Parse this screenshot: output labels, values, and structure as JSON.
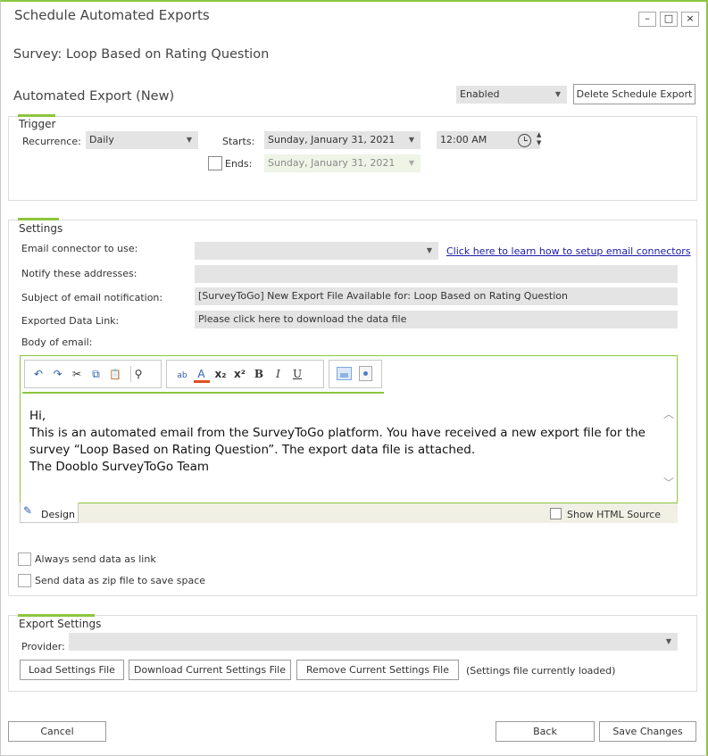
{
  "window": {
    "title": "Schedule Automated Exports",
    "minimize": "–",
    "maximize": "□",
    "close": "×"
  },
  "survey_title": "Survey: Loop Based on Rating Question",
  "export_title": "Automated Export (New)",
  "status_select": "Enabled",
  "delete_button": "Delete Schedule Export",
  "trigger": {
    "label": "Trigger",
    "recurrence_label": "Recurrence:",
    "recurrence_value": "Daily",
    "starts_label": "Starts:",
    "starts_value": "Sunday, January 31, 2021",
    "time_value": "12:00 AM",
    "ends_label": "Ends:",
    "ends_value": "Sunday, January 31, 2021"
  },
  "settings": {
    "label": "Settings",
    "connector_label": "Email connector to use:",
    "connector_value": "",
    "connector_link": "Click here to learn how to setup email connectors",
    "notify_label": "Notify these addresses:",
    "notify_value": "",
    "subject_label": "Subject of email notification:",
    "subject_value": "[SurveyToGo] New Export File Available for: Loop Based on Rating Question",
    "link_label": "Exported Data Link:",
    "link_value": "Please click here to download the data file",
    "body_label": "Body of email:",
    "body_lines": [
      "Hi,",
      "This is an automated email from the SurveyToGo platform. You have received a new export file for the",
      "survey “Loop Based on Rating Question”. The export data file is attached.",
      "The Dooblo SurveyToGo Team"
    ],
    "design_tab": "Design",
    "show_html": "Show HTML Source",
    "always_link": "Always send data as link",
    "zip": "Send data as zip file to save space"
  },
  "export_settings": {
    "label": "Export Settings",
    "provider_label": "Provider:",
    "provider_value": "",
    "load_button": "Load Settings File",
    "download_button": "Download Current Settings File",
    "remove_button": "Remove Current Settings File",
    "status_text": "(Settings file currently loaded)"
  },
  "footer": {
    "cancel": "Cancel",
    "back": "Back",
    "save": "Save Changes"
  },
  "toolbar": {
    "undo": "↶",
    "redo": "↷",
    "cut": "✂",
    "copy": "⧉",
    "paste": "📋",
    "find": "⚲",
    "spell": "ab",
    "font_color": "A",
    "subscript": "x₂",
    "superscript": "x²",
    "bold": "B",
    "italic": "I",
    "underline": "U"
  }
}
